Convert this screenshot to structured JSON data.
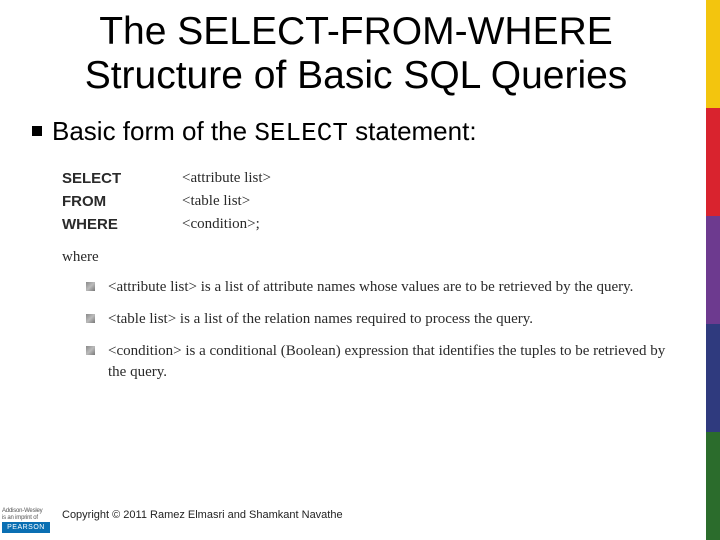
{
  "title": "The SELECT-FROM-WHERE Structure of Basic SQL Queries",
  "bullet": {
    "prefix": "Basic form of the ",
    "code": "SELECT",
    "suffix": " statement:"
  },
  "syntax": [
    {
      "keyword": "SELECT",
      "arg": "<attribute list>"
    },
    {
      "keyword": "FROM",
      "arg": "<table list>"
    },
    {
      "keyword": "WHERE",
      "arg": "<condition>;"
    }
  ],
  "where_label": "where",
  "sublist": [
    "<attribute list> is a list of attribute names whose values are to be retrieved by the query.",
    "<table list> is a list of the relation names required to process the query.",
    "<condition> is a conditional (Boolean) expression that identifies the tuples to be retrieved by the query."
  ],
  "footer": {
    "logo_top": "Addison-Wesley",
    "logo_sub": "is an imprint of",
    "logo_brand": "PEARSON",
    "copyright": "Copyright © 2011 Ramez Elmasri and Shamkant Navathe"
  }
}
